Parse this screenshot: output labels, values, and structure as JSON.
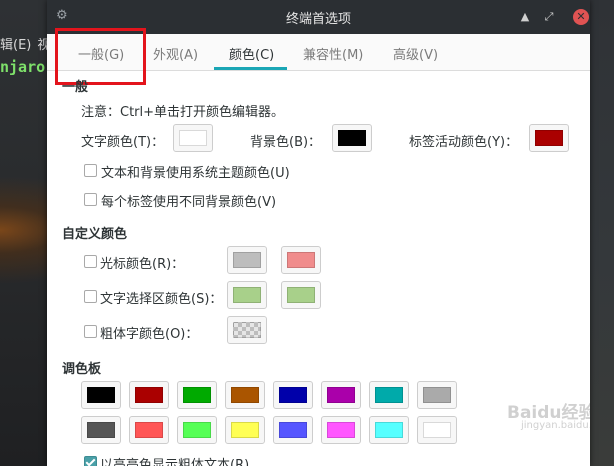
{
  "terminal": {
    "menu": [
      "辑(E)",
      "视"
    ],
    "prompt": "njaro"
  },
  "dialog": {
    "title": "终端首选项",
    "window_buttons": {
      "minimize": "▲",
      "maximize": "⤢",
      "close": "✕"
    }
  },
  "tabs": [
    {
      "label": "一般(G)",
      "active": false
    },
    {
      "label": "外观(A)",
      "active": false
    },
    {
      "label": "颜色(C)",
      "active": true
    },
    {
      "label": "兼容性(M)",
      "active": false
    },
    {
      "label": "高级(V)",
      "active": false
    }
  ],
  "general": {
    "title": "一般",
    "note": "注意：Ctrl+单击打开颜色编辑器。",
    "text_color_label": "文字颜色(T)：",
    "bg_color_label": "背景色(B)：",
    "tab_active_color_label": "标签活动颜色(Y)：",
    "colors": {
      "text": "#ffffff",
      "background": "#000000",
      "tab_active": "#aa0000"
    },
    "use_system_theme": {
      "label": "文本和背景使用系统主题颜色(U)",
      "checked": false
    },
    "per_tab_bg": {
      "label": "每个标签使用不同背景颜色(V)",
      "checked": false
    }
  },
  "custom": {
    "title": "自定义颜色",
    "cursor": {
      "label": "光标颜色(R)：",
      "checked": false,
      "colors": [
        "#bdbdbd",
        "#f08c8c"
      ]
    },
    "selection": {
      "label": "文字选择区颜色(S)：",
      "checked": false,
      "colors": [
        "#a8d08a",
        "#a8d08a"
      ]
    },
    "bold": {
      "label": "粗体字颜色(O)：",
      "checked": false,
      "colors": [
        "transparent"
      ]
    }
  },
  "palette": {
    "title": "调色板",
    "row1": [
      "#000000",
      "#aa0000",
      "#00aa00",
      "#aa5500",
      "#0000aa",
      "#aa00aa",
      "#00aaaa",
      "#aaaaaa"
    ],
    "row2": [
      "#555555",
      "#ff5555",
      "#55ff55",
      "#ffff55",
      "#5555ff",
      "#ff55ff",
      "#55ffff",
      "#ffffff"
    ],
    "bright_bold": {
      "label": "以高亮色显示粗体文本(R)",
      "checked": true
    }
  },
  "watermark": {
    "text": "Baidu经验",
    "sub": "jingyan.baidu.com"
  }
}
